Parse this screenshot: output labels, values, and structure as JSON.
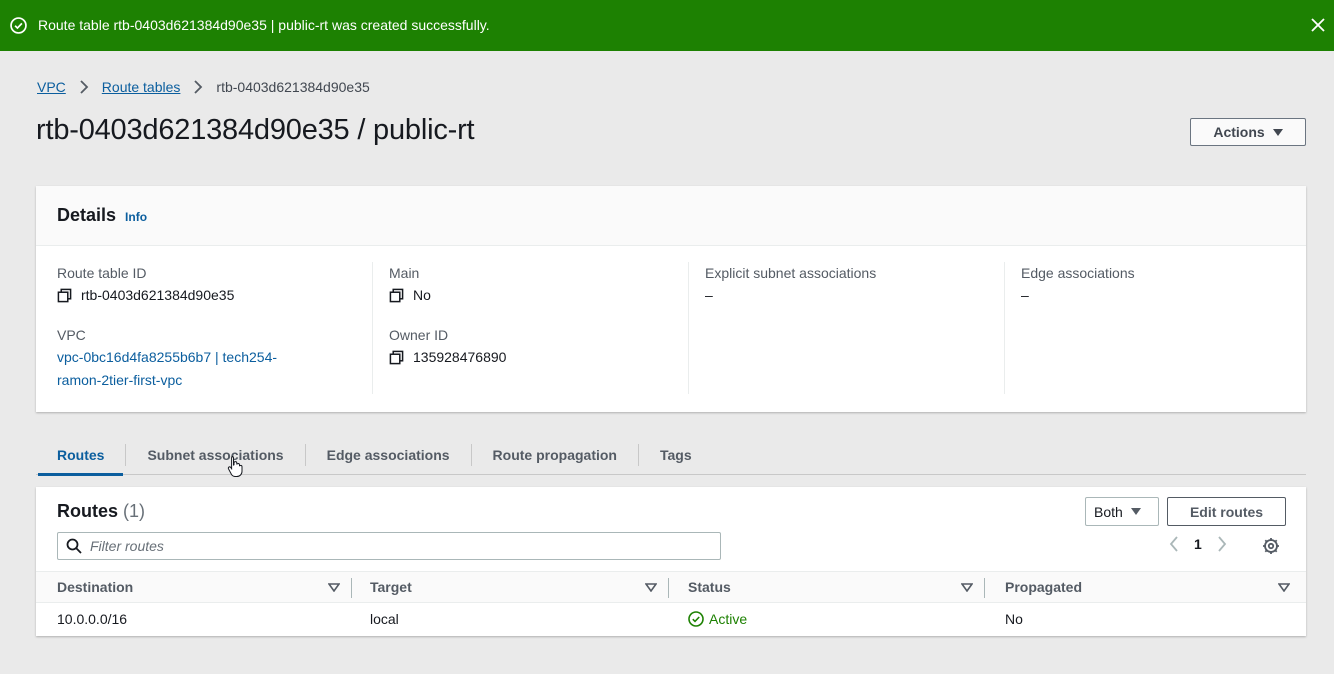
{
  "flash": {
    "message": "Route table rtb-0403d621384d90e35 | public-rt was created successfully.",
    "type": "success",
    "color": "#1d8102"
  },
  "breadcrumb": [
    "VPC",
    "Route tables",
    "rtb-0403d621384d90e35"
  ],
  "page": {
    "title": "rtb-0403d621384d90e35 / public-rt",
    "actions_label": "Actions"
  },
  "details": {
    "title": "Details",
    "info_label": "Info",
    "route_table_id_label": "Route table ID",
    "route_table_id": "rtb-0403d621384d90e35",
    "vpc_label": "VPC",
    "vpc_line1": "vpc-0bc16d4fa8255b6b7 | tech254-",
    "vpc_line2": "ramon-2tier-first-vpc",
    "main_label": "Main",
    "main_value": "No",
    "owner_label": "Owner ID",
    "owner_value": "135928476890",
    "explicit_label": "Explicit subnet associations",
    "explicit_value": "–",
    "edge_label": "Edge associations",
    "edge_value": "–"
  },
  "tabs": [
    {
      "label": "Routes",
      "active": true
    },
    {
      "label": "Subnet associations",
      "active": false
    },
    {
      "label": "Edge associations",
      "active": false
    },
    {
      "label": "Route propagation",
      "active": false
    },
    {
      "label": "Tags",
      "active": false
    }
  ],
  "routes": {
    "title": "Routes",
    "count": "(1)",
    "filter_selected": "Both",
    "edit_label": "Edit routes",
    "search_placeholder": "Filter routes",
    "page": "1",
    "columns": [
      "Destination",
      "Target",
      "Status",
      "Propagated"
    ],
    "rows": [
      {
        "destination": "10.0.0.0/16",
        "target": "local",
        "status": "Active",
        "propagated": "No"
      }
    ]
  },
  "colors": {
    "link": "#0b5e9e",
    "success": "#1d8102"
  }
}
